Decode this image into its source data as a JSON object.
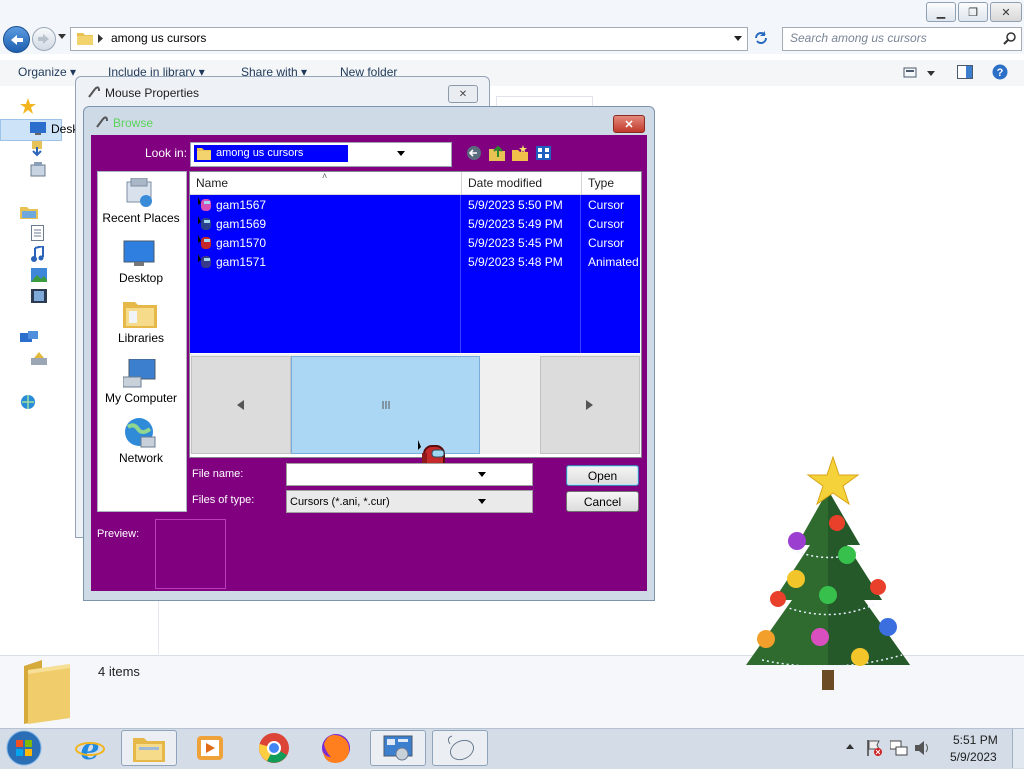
{
  "explorer": {
    "address_path": "among us cursors",
    "search_placeholder": "Search among us cursors",
    "toolbar": {
      "organize": "Organize ▾",
      "include_in_library": "Include in library ▾",
      "share_with": "Share with ▾",
      "new_folder": "New folder"
    },
    "nav_partial_label": "Desk",
    "status": {
      "items_count": "4 items"
    }
  },
  "mouse_properties": {
    "title": "Mouse Properties"
  },
  "browse_dialog": {
    "title": "Browse",
    "look_in_label": "Look in:",
    "look_in_value": "among us cursors",
    "places": [
      "Recent Places",
      "Desktop",
      "Libraries",
      "My Computer",
      "Network"
    ],
    "columns": {
      "name": "Name",
      "date_modified": "Date modified",
      "type": "Type"
    },
    "files": [
      {
        "name": "gam1567",
        "date": "5/9/2023 5:50 PM",
        "type": "Cursor"
      },
      {
        "name": "gam1569",
        "date": "5/9/2023 5:49 PM",
        "type": "Cursor"
      },
      {
        "name": "gam1570",
        "date": "5/9/2023 5:45 PM",
        "type": "Cursor"
      },
      {
        "name": "gam1571",
        "date": "5/9/2023 5:48 PM",
        "type": "Animated"
      }
    ],
    "file_name_label": "File name:",
    "file_name_value": "",
    "files_of_type_label": "Files of type:",
    "files_of_type_value": "Cursors (*.ani, *.cur)",
    "open_button": "Open",
    "cancel_button": "Cancel",
    "preview_label": "Preview:"
  },
  "taskbar": {
    "clock_time": "5:51 PM",
    "clock_date": "5/9/2023"
  },
  "colors": {
    "dialog_bg": "#800080",
    "selection_blue": "#0000ff",
    "scroll_thumb": "#abd7f4"
  }
}
